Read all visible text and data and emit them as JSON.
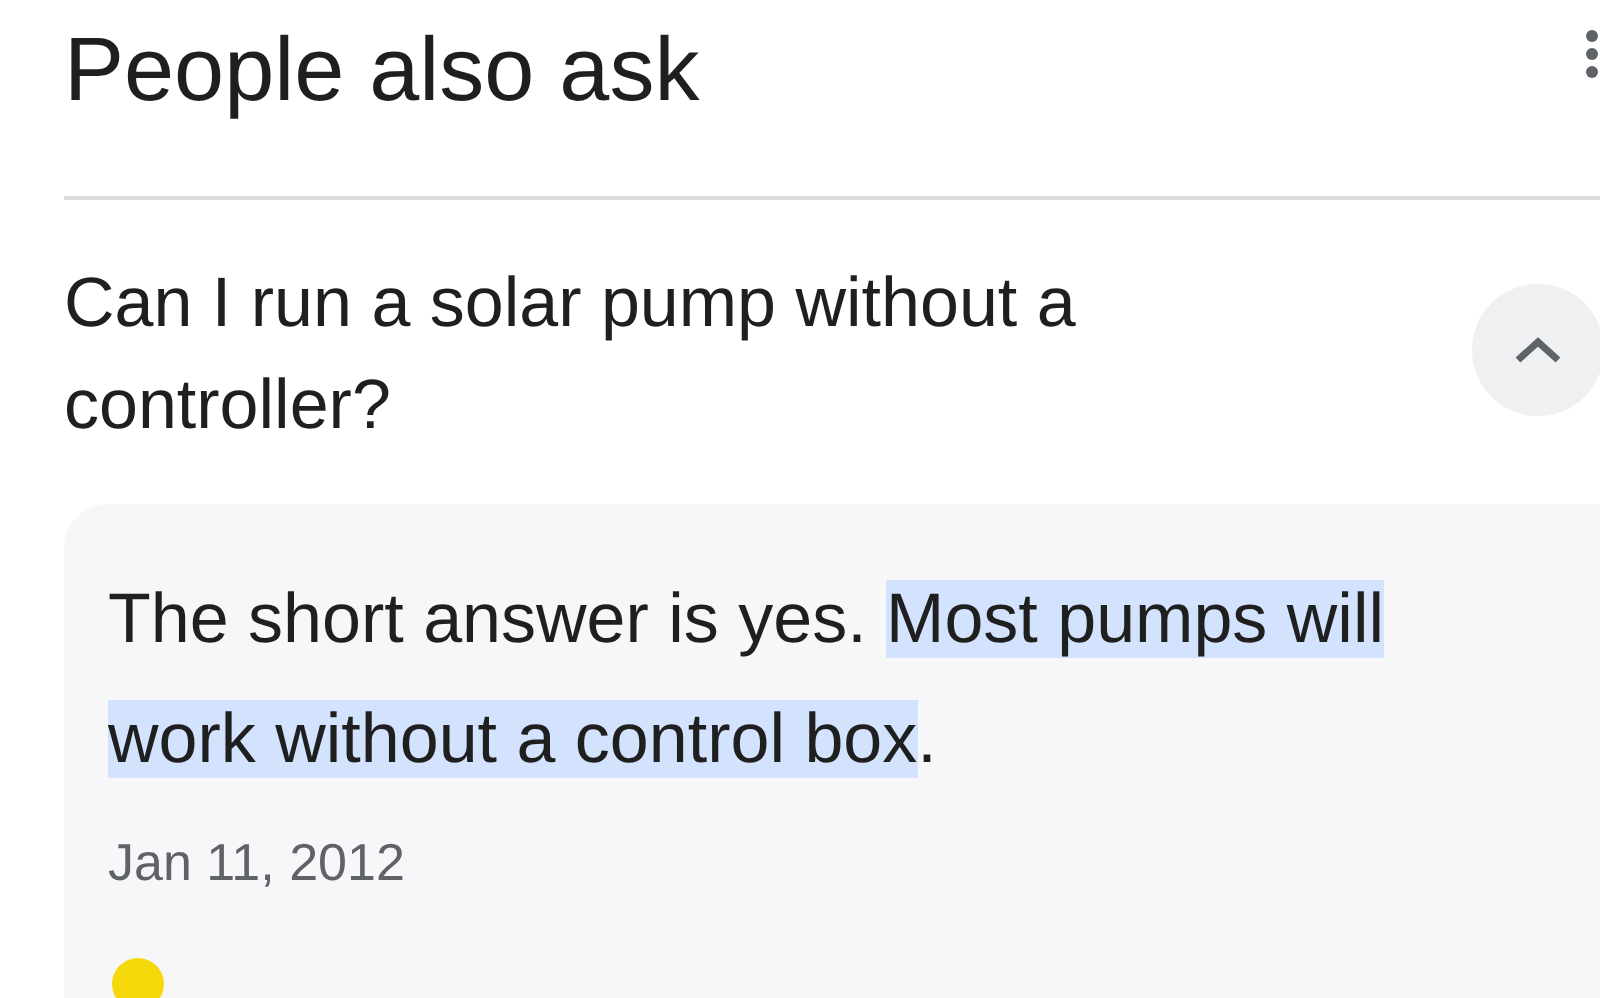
{
  "heading": "People also ask",
  "question": {
    "text": "Can I run a solar pump without a controller?",
    "expanded": true
  },
  "answer": {
    "segments": [
      {
        "text": "The short answer is yes. ",
        "highlighted": false
      },
      {
        "text": "Most pumps will work without a control box",
        "highlighted": true
      },
      {
        "text": ".",
        "highlighted": false
      }
    ],
    "date": "Jan 11, 2012"
  }
}
